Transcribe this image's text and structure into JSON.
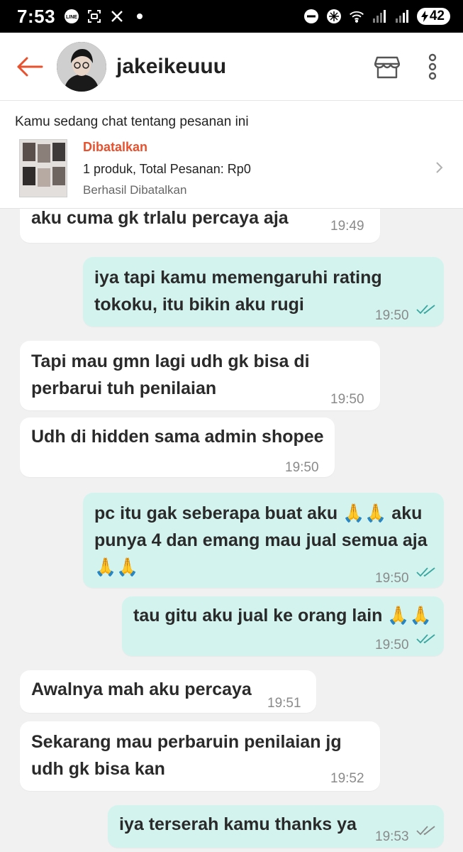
{
  "statusbar": {
    "time": "7:53",
    "battery": "42",
    "signal_label": "5"
  },
  "header": {
    "username": "jakeikeuuu"
  },
  "order": {
    "title": "Kamu sedang chat tentang pesanan ini",
    "status": "Dibatalkan",
    "info": "1 produk, Total Pesanan: Rp0",
    "sub": "Berhasil Dibatalkan"
  },
  "messages": [
    {
      "dir": "in",
      "text": "aku cuma gk trlalu percaya aja",
      "time": "19:49"
    },
    {
      "dir": "out",
      "text": "iya tapi kamu memengaruhi rating\ntokoku, itu bikin aku rugi",
      "time": "19:50",
      "read": true
    },
    {
      "dir": "in",
      "text": "Tapi mau gmn lagi udh gk bisa di\nperbarui tuh penilaian",
      "time": "19:50"
    },
    {
      "dir": "in",
      "text": "Udh di hidden sama admin shopee",
      "time": "19:50"
    },
    {
      "dir": "out",
      "text": "pc itu gak seberapa buat aku 🙏🙏 aku\npunya 4 dan emang mau jual semua aja\n🙏🙏",
      "time": "19:50",
      "read": true
    },
    {
      "dir": "out",
      "text": "tau gitu aku jual ke orang lain 🙏🙏",
      "time": "19:50",
      "read": true
    },
    {
      "dir": "in",
      "text": "Awalnya mah aku percaya",
      "time": "19:51"
    },
    {
      "dir": "in",
      "text": "Sekarang mau perbaruin penilaian jg\nudh gk bisa kan",
      "time": "19:52"
    },
    {
      "dir": "out",
      "text": "iya terserah kamu thanks ya",
      "time": "19:53",
      "read": false
    }
  ],
  "colors": {
    "accent": "#e8512e",
    "outgoing_bubble": "#d3f4ee",
    "incoming_bubble": "#ffffff",
    "read_tick": "#3aa6a0",
    "sent_tick": "#8a8a8a"
  },
  "icons": [
    "back-arrow-icon",
    "shop-icon",
    "more-vert-icon",
    "chevron-right-icon",
    "double-check-icon"
  ]
}
